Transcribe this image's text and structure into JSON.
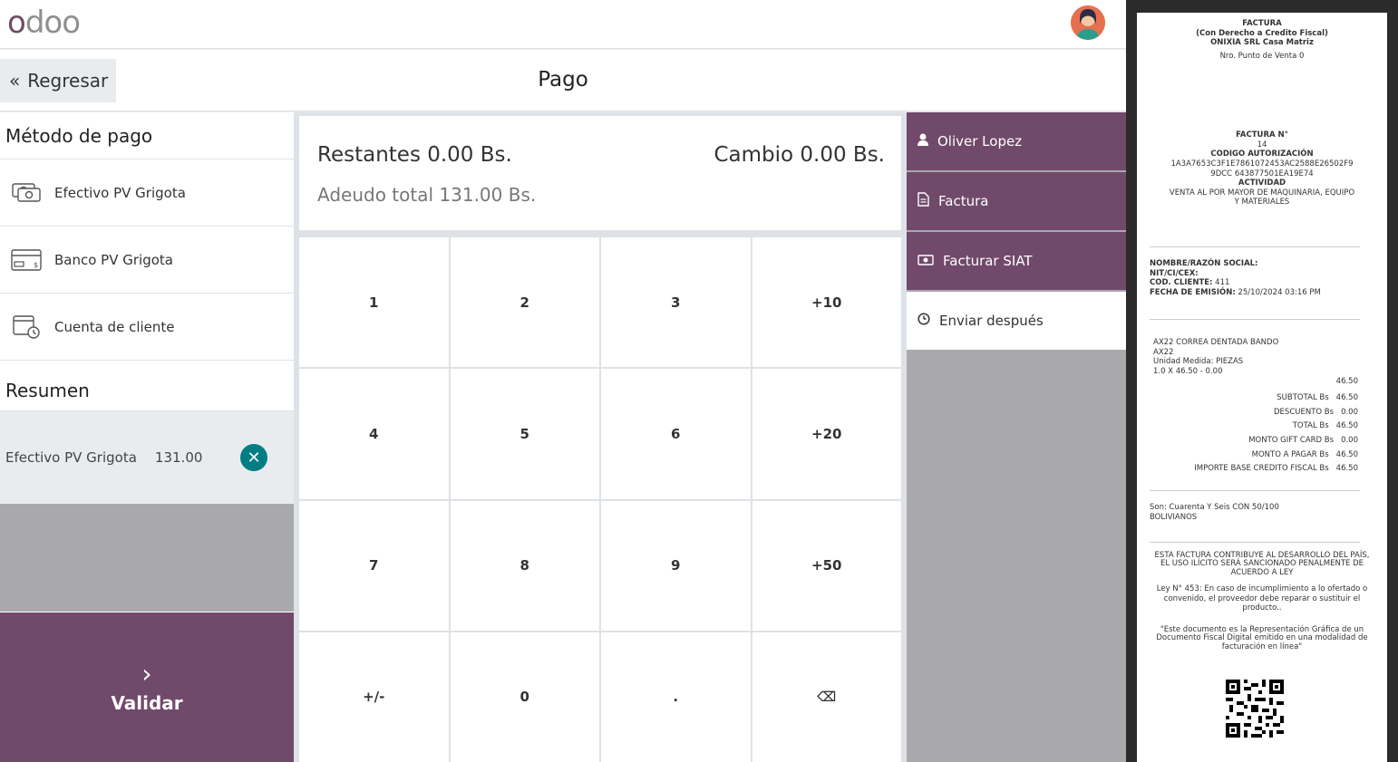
{
  "topbar": {
    "logo": "odoo",
    "avatar_icon": "user-avatar-icon"
  },
  "header": {
    "back_label": "Regresar",
    "title": "Pago"
  },
  "payment_methods": {
    "title": "Método de pago",
    "items": [
      {
        "label": "Efectivo PV Grigota",
        "icon": "cash-icon"
      },
      {
        "label": "Banco PV Grigota",
        "icon": "bank-card-icon"
      },
      {
        "label": "Cuenta de cliente",
        "icon": "customer-account-icon"
      }
    ]
  },
  "summary": {
    "title": "Resumen",
    "lines": [
      {
        "method": "Efectivo PV Grigota",
        "amount": "131.00"
      }
    ]
  },
  "validate": {
    "label": "Validar"
  },
  "status": {
    "remaining_label": "Restantes",
    "remaining_value": "0.00 Bs.",
    "change_label": "Cambio",
    "change_value": "0.00 Bs.",
    "due_label": "Adeudo total",
    "due_value": "131.00 Bs."
  },
  "numpad": [
    "1",
    "2",
    "3",
    "+10",
    "4",
    "5",
    "6",
    "+20",
    "7",
    "8",
    "9",
    "+50",
    "+/-",
    "0",
    ".",
    "⌫"
  ],
  "actions": [
    {
      "label": "Oliver Lopez",
      "icon": "user-icon"
    },
    {
      "label": "Factura",
      "icon": "document-icon"
    },
    {
      "label": "Facturar SIAT",
      "icon": "money-icon"
    },
    {
      "label": "Enviar después",
      "icon": "clock-icon"
    }
  ],
  "receipt": {
    "header": [
      "FACTURA",
      "(Con Derecho a Credito Fiscal)",
      "ONIXIA SRL Casa Matriz"
    ],
    "pos": "Nro. Punto de Venta 0",
    "invoice_no_label": "FACTURA N°",
    "invoice_no": "14",
    "auth_label": "CODIGO AUTORIZACIÓN",
    "auth_code_1": "1A3A7653C3F1E7861072453AC2588E26502F9",
    "auth_code_2": "9DCC 643877501EA19E74",
    "activity_label": "ACTIVIDAD",
    "activity": "VENTA AL POR MAYOR DE MAQUINARIA, EQUIPO Y MATERIALES",
    "name_label": "NOMBRE/RAZÓN SOCIAL:",
    "nit_label": "NIT/CI/CEX:",
    "client_label": "COD. CLIENTE:",
    "client_value": "411",
    "date_label": "FECHA DE EMISIÓN:",
    "date_value": "25/10/2024 03:16 PM",
    "product_name": "AX22 CORREA DENTADA BANDO",
    "product_code": "AX22",
    "product_unit": "Unidad Medida: PIEZAS",
    "product_qty": "1.0 X 46.50 - 0.00",
    "product_total": "46.50",
    "totals": [
      {
        "label": "SUBTOTAL Bs",
        "value": "46.50"
      },
      {
        "label": "DESCUENTO Bs",
        "value": "0.00"
      },
      {
        "label": "TOTAL Bs",
        "value": "46.50"
      },
      {
        "label": "MONTO GIFT CARD Bs",
        "value": "0.00"
      },
      {
        "label": "MONTO A PAGAR Bs",
        "value": "46.50"
      },
      {
        "label": "IMPORTE BASE CREDITO FISCAL Bs",
        "value": "46.50"
      }
    ],
    "amount_words": "Son: Cuarenta Y Seis CON 50/100 BOLIVIANOS",
    "legend_1": "ESTA FACTURA CONTRIBUYE AL DESARROLLO DEL PAÍS, EL USO ILÍCITO SERÁ SANCIONADO PENALMENTE DE ACUERDO A LEY",
    "legend_2": "Ley N° 453: En caso de incumplimiento a lo ofertado o convenido, el proveedor debe reparar o sustituir el producto..",
    "legend_3": "\"Este documento es la Representación Gráfica de un Documento Fiscal Digital emitido en una modalidad de facturación en línea\"",
    "qr_icon": "qr-code-icon"
  }
}
